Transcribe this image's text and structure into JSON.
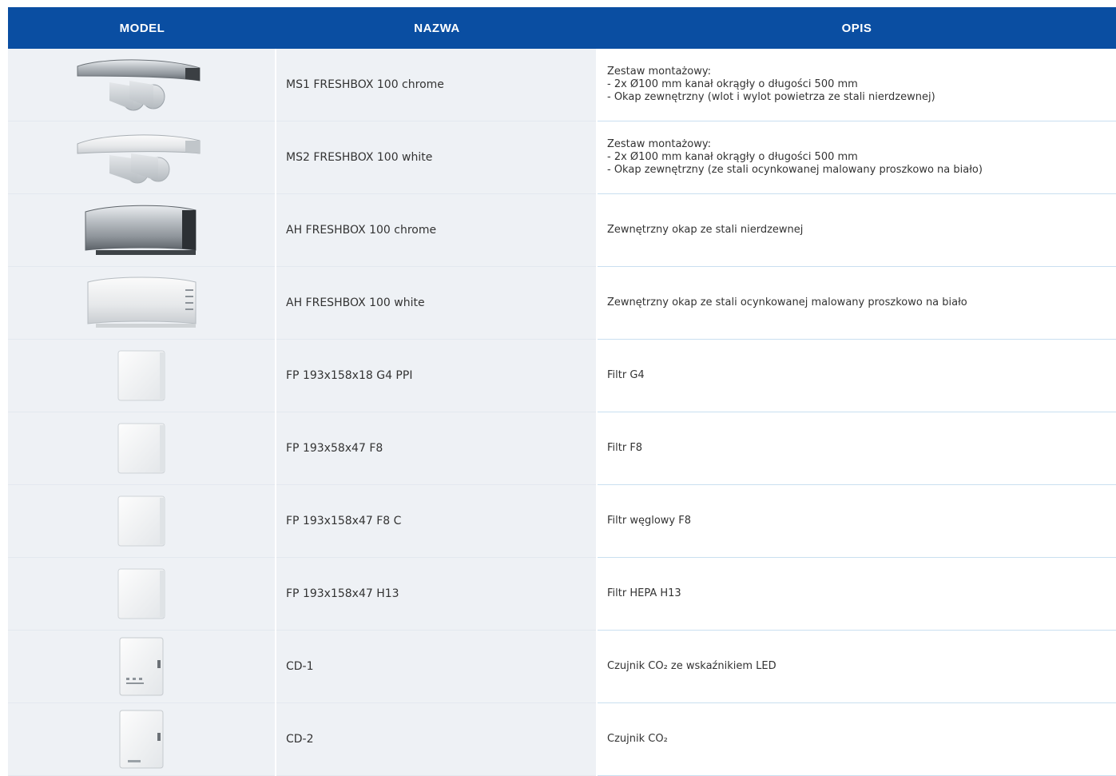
{
  "header": {
    "model": "MODEL",
    "name": "NAZWA",
    "description": "OPIS"
  },
  "rows": [
    {
      "icon": "hood-chrome-with-ducts",
      "name": "MS1 FRESHBOX 100 chrome",
      "desc": [
        "Zestaw montażowy:",
        "- 2x Ø100 mm kanał okrągły o długości 500 mm",
        "- Okap zewnętrzny (wlot i wylot powietrza ze stali nierdzewnej)"
      ]
    },
    {
      "icon": "hood-white-with-ducts",
      "name": "MS2 FRESHBOX 100 white",
      "desc": [
        "Zestaw montażowy:",
        "- 2x Ø100 mm kanał okrągły o długości 500 mm",
        "- Okap zewnętrzny (ze stali ocynkowanej malowany proszkowo na biało)"
      ]
    },
    {
      "icon": "hood-chrome",
      "name": "AH FRESHBOX 100 chrome",
      "desc": [
        "Zewnętrzny okap ze stali nierdzewnej"
      ]
    },
    {
      "icon": "hood-white",
      "name": "AH FRESHBOX 100 white",
      "desc": [
        "Zewnętrzny okap ze stali ocynkowanej malowany proszkowo na biało"
      ]
    },
    {
      "icon": "filter-panel",
      "name": "FP 193x158x18 G4 PPI",
      "desc": [
        "Filtr G4"
      ]
    },
    {
      "icon": "filter-panel",
      "name": "FP 193x58x47 F8",
      "desc": [
        "Filtr F8"
      ]
    },
    {
      "icon": "filter-panel",
      "name": "FP 193x158x47 F8 C",
      "desc": [
        "Filtr węglowy F8"
      ]
    },
    {
      "icon": "filter-panel",
      "name": "FP 193x158x47 H13",
      "desc": [
        "Filtr HEPA H13"
      ]
    },
    {
      "icon": "co2-sensor-led",
      "name": "CD-1",
      "desc": [
        "Czujnik CO₂ ze wskaźnikiem LED"
      ]
    },
    {
      "icon": "co2-sensor",
      "name": "CD-2",
      "desc": [
        "Czujnik CO₂"
      ]
    }
  ]
}
